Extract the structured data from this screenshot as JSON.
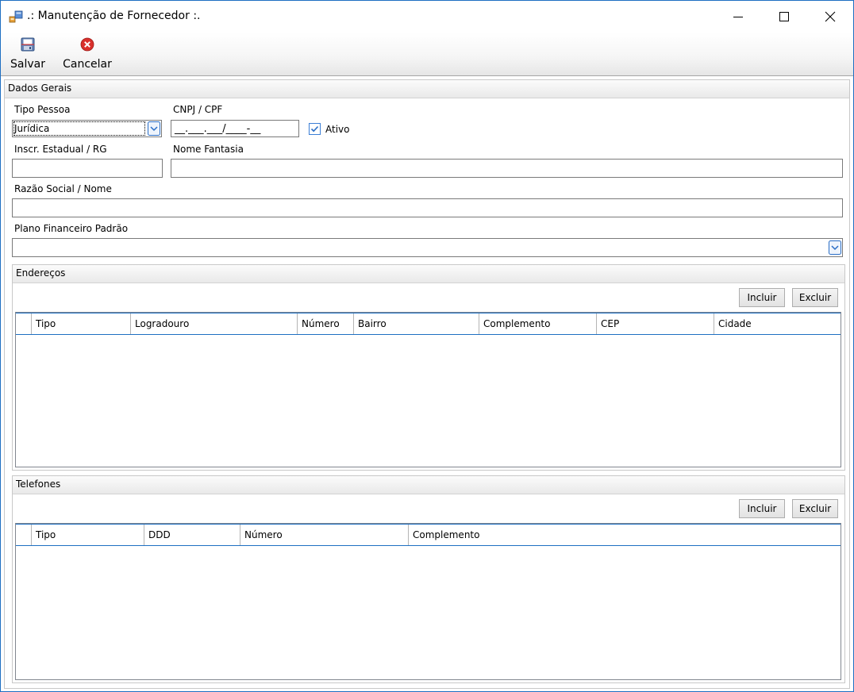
{
  "window": {
    "title": ".: Manutenção de Fornecedor :.",
    "controls": {
      "minimize": "minimize-icon",
      "maximize": "maximize-icon",
      "close": "close-icon"
    }
  },
  "toolbar": {
    "save_label": "Salvar",
    "cancel_label": "Cancelar"
  },
  "dados_gerais": {
    "header": "Dados Gerais",
    "tipo_pessoa_label": "Tipo Pessoa",
    "tipo_pessoa_value": "Jurídica",
    "cnpj_label": "CNPJ / CPF",
    "cnpj_value": "__.___.___/____-__",
    "ativo_label": "Ativo",
    "ativo_checked": true,
    "inscr_label": "Inscr. Estadual / RG",
    "inscr_value": "",
    "fantasia_label": "Nome Fantasia",
    "fantasia_value": "",
    "razao_label": "Razão Social / Nome",
    "razao_value": "",
    "plano_label": "Plano Financeiro Padrão",
    "plano_value": ""
  },
  "enderecos": {
    "header": "Endereços",
    "incluir_label": "Incluir",
    "excluir_label": "Excluir",
    "columns": [
      "Tipo",
      "Logradouro",
      "Número",
      "Bairro",
      "Complemento",
      "CEP",
      "Cidade"
    ],
    "rows": []
  },
  "telefones": {
    "header": "Telefones",
    "incluir_label": "Incluir",
    "excluir_label": "Excluir",
    "columns": [
      "Tipo",
      "DDD",
      "Número",
      "Complemento"
    ],
    "rows": []
  },
  "colors": {
    "accent": "#1e6fc2",
    "cancel_red": "#d9302c"
  }
}
